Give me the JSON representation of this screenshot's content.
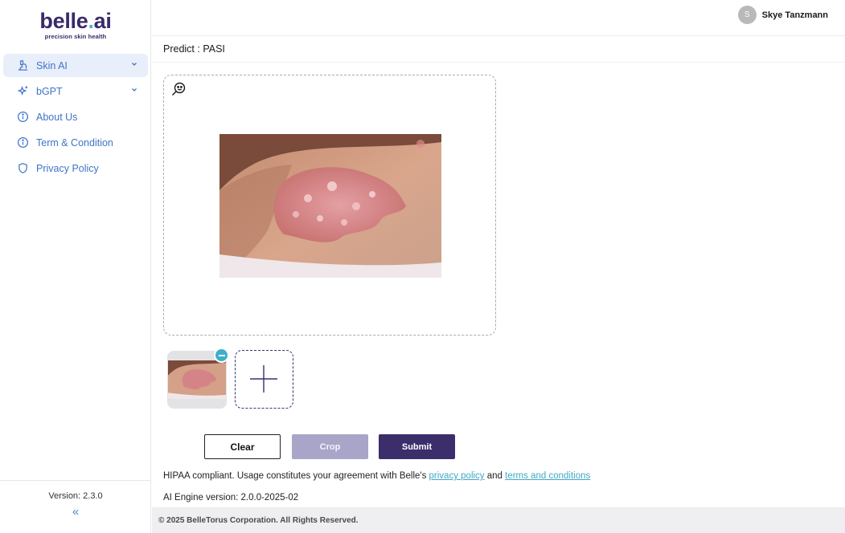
{
  "brand": {
    "name_main": "belle",
    "name_dot": ".",
    "name_suffix": "ai",
    "tagline": "precision skin health"
  },
  "sidebar": {
    "items": [
      {
        "label": "Skin AI",
        "icon": "microscope-icon",
        "active": true,
        "expandable": true
      },
      {
        "label": "bGPT",
        "icon": "sparkle-icon",
        "active": false,
        "expandable": true
      },
      {
        "label": "About Us",
        "icon": "info-icon",
        "active": false,
        "expandable": false
      },
      {
        "label": "Term & Condition",
        "icon": "info-icon",
        "active": false,
        "expandable": false
      },
      {
        "label": "Privacy Policy",
        "icon": "shield-icon",
        "active": false,
        "expandable": false
      }
    ],
    "version": "Version: 2.3.0",
    "collapse_glyph": "«"
  },
  "header": {
    "user_initial": "S",
    "user_name": "Skye Tanzmann"
  },
  "main": {
    "page_title": "Predict : PASI",
    "buttons": {
      "clear": "Clear",
      "crop": "Crop",
      "submit": "Submit"
    },
    "hipaa": {
      "prefix": "HIPAA compliant. Usage constitutes your agreement with Belle's ",
      "privacy_link": "privacy policy",
      "and": " and ",
      "terms_link": "terms and conditions"
    },
    "engine_version": "AI Engine version: 2.0.0-2025-02"
  },
  "footer": {
    "copyright": "© 2025 BelleTorus Corporation. All Rights Reserved."
  },
  "colors": {
    "brand_purple": "#3b2e6b",
    "accent_teal": "#3fa8c4",
    "nav_blue": "#3f74c7",
    "active_bg": "#e8eefa",
    "crop_disabled": "#a8a5c8"
  }
}
